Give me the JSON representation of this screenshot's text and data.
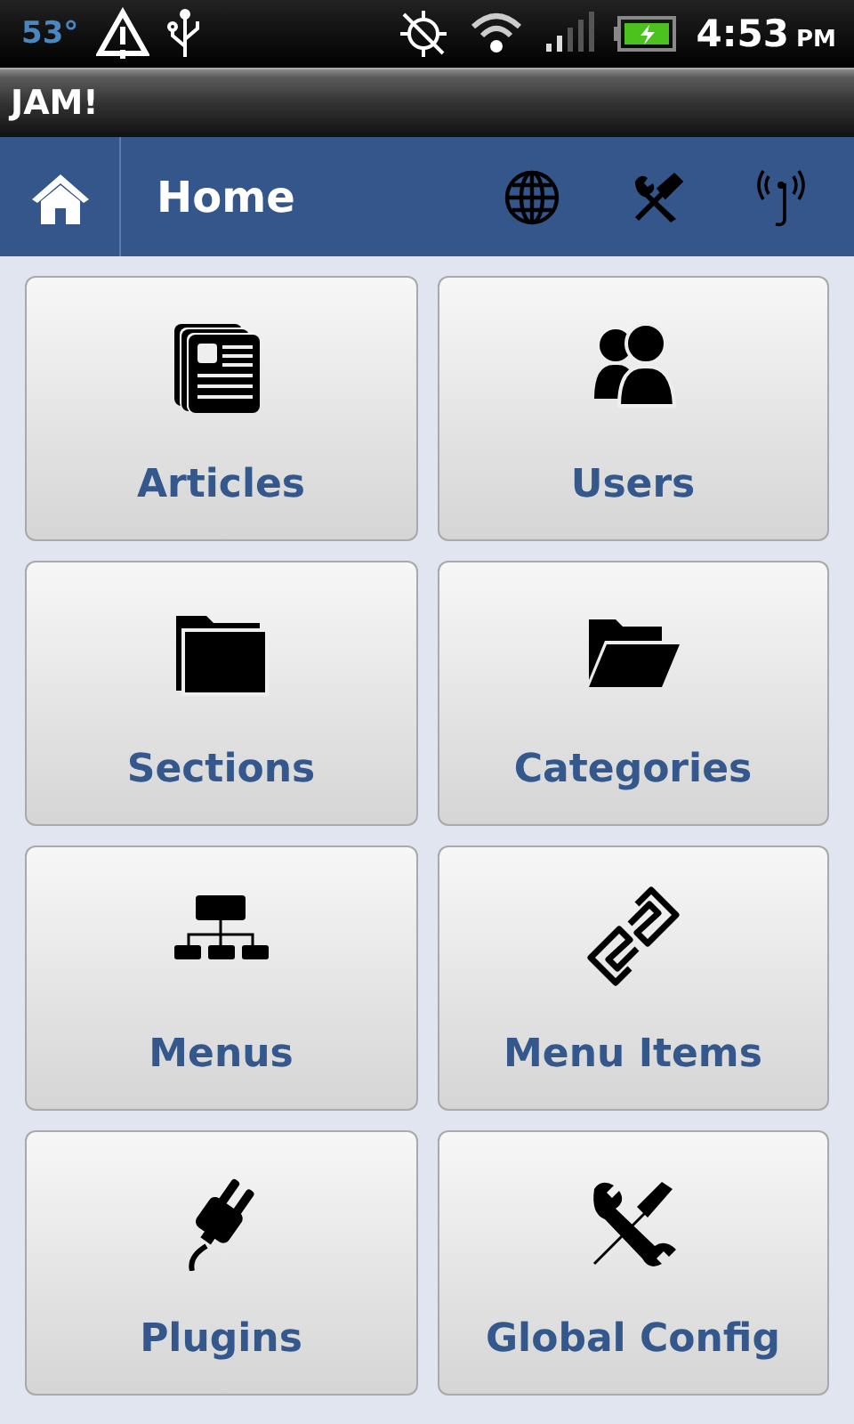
{
  "status_bar": {
    "temperature": "53°",
    "time": "4:53",
    "meridiem": "PM"
  },
  "app_title": "JAM!",
  "header": {
    "title": "Home"
  },
  "tiles": [
    {
      "label": "Articles",
      "kind": "articles"
    },
    {
      "label": "Users",
      "kind": "users"
    },
    {
      "label": "Sections",
      "kind": "folder"
    },
    {
      "label": "Categories",
      "kind": "open-folder"
    },
    {
      "label": "Menus",
      "kind": "sitemap"
    },
    {
      "label": "Menu Items",
      "kind": "link"
    },
    {
      "label": "Plugins",
      "kind": "plug"
    },
    {
      "label": "Global Config",
      "kind": "tools"
    }
  ]
}
